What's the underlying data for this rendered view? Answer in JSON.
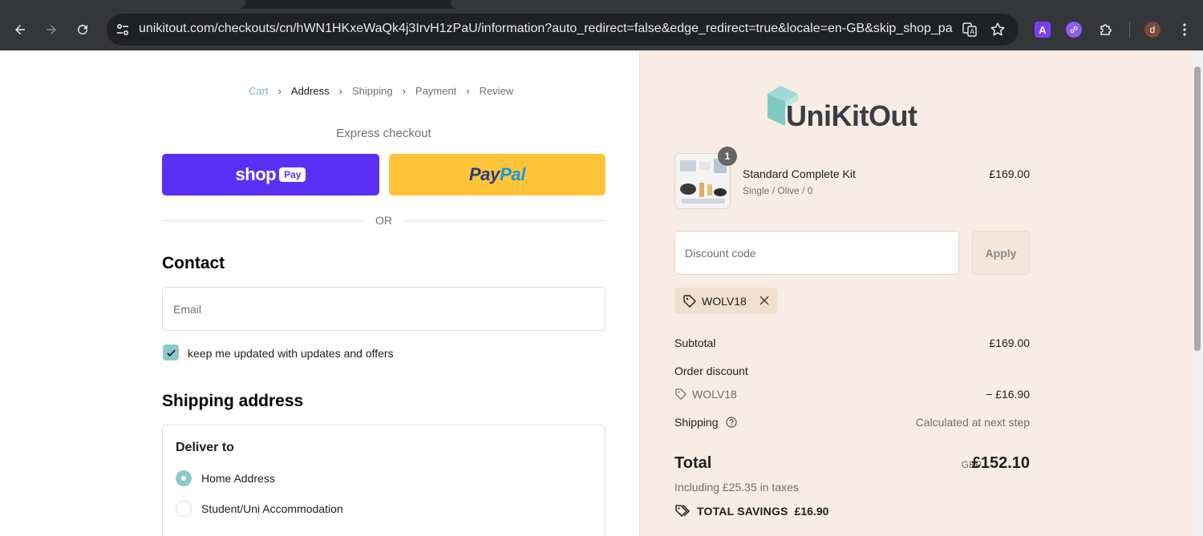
{
  "browser": {
    "url": "unikitout.com/checkouts/cn/hWN1HKxeWaQk4j3IrvH1zPaU/information?auto_redirect=false&edge_redirect=true&locale=en-GB&skip_shop_pay=t...",
    "profile_initial": "d",
    "extension_a": "A"
  },
  "breadcrumb": [
    "Cart",
    "Address",
    "Shipping",
    "Payment",
    "Review"
  ],
  "express": {
    "title": "Express checkout",
    "shop_word": "shop",
    "shop_pay_badge": "Pay",
    "paypal_pay": "Pay",
    "paypal_pal": "Pal",
    "or_text": "OR"
  },
  "contact": {
    "heading": "Contact",
    "email_placeholder": "Email",
    "newsletter_label": "keep me updated with updates and offers",
    "newsletter_checked": true
  },
  "shipping": {
    "heading": "Shipping address",
    "deliver_to": "Deliver to",
    "options": [
      {
        "label": "Home Address",
        "selected": true
      },
      {
        "label": "Student/Uni Accommodation",
        "selected": false
      }
    ]
  },
  "summary": {
    "brand": "UniKitOut",
    "product": {
      "name": "Standard Complete Kit",
      "variant": "Single / Olive / 0",
      "price": "£169.00",
      "quantity": "1"
    },
    "discount_placeholder": "Discount code",
    "apply_label": "Apply",
    "applied_code": "WOLV18",
    "subtotal_label": "Subtotal",
    "subtotal_value": "£169.00",
    "order_discount_label": "Order discount",
    "order_discount_code": "WOLV18",
    "order_discount_value": "− £16.90",
    "shipping_label": "Shipping",
    "shipping_value": "Calculated at next step",
    "total_label": "Total",
    "total_currency": "GBP",
    "total_value": "£152.10",
    "tax_note": "Including £25.35 in taxes",
    "savings_label": "TOTAL SAVINGS",
    "savings_value": "£16.90"
  },
  "colors": {
    "shop_pay": "#5a31f4",
    "paypal": "#ffc439",
    "accent_teal": "#8ec9c9",
    "summary_bg": "#f9ece4"
  }
}
